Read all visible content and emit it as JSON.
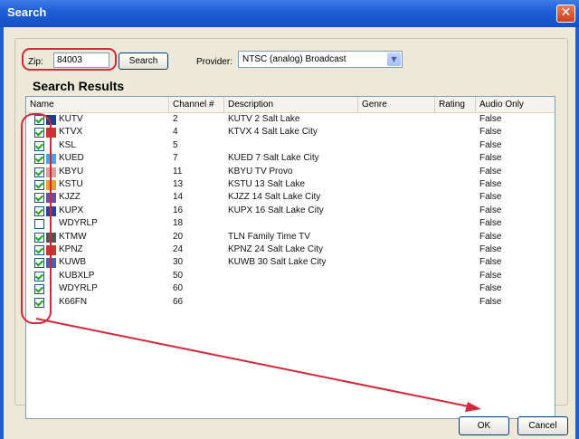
{
  "window": {
    "title": "Search",
    "close_glyph": "✕"
  },
  "search": {
    "zip_label": "Zip:",
    "zip_value": "84003",
    "search_button": "Search",
    "provider_label": "Provider:",
    "provider_value": "NTSC (analog) Broadcast"
  },
  "results": {
    "heading": "Search Results",
    "columns": [
      "Name",
      "Channel #",
      "Description",
      "Genre",
      "Rating",
      "Audio Only"
    ],
    "rows": [
      {
        "checked": true,
        "logo": "#1b3f8c",
        "name": "KUTV",
        "channel": "2",
        "description": "KUTV 2 Salt Lake",
        "genre": "",
        "rating": "",
        "audio_only": "False"
      },
      {
        "checked": true,
        "logo": "#c23b2a",
        "name": "KTVX",
        "channel": "4",
        "description": "KTVX 4 Salt Lake City",
        "genre": "",
        "rating": "",
        "audio_only": "False"
      },
      {
        "checked": true,
        "logo": "",
        "name": "KSL",
        "channel": "5",
        "description": "",
        "genre": "",
        "rating": "",
        "audio_only": "False"
      },
      {
        "checked": true,
        "logo": "#44a7e0",
        "name": "KUED",
        "channel": "7",
        "description": "KUED 7 Salt Lake City",
        "genre": "",
        "rating": "",
        "audio_only": "False"
      },
      {
        "checked": true,
        "logo": "#d9a0a0",
        "name": "KBYU",
        "channel": "11",
        "description": "KBYU TV Provo",
        "genre": "",
        "rating": "",
        "audio_only": "False"
      },
      {
        "checked": true,
        "logo": "#e2a12b",
        "name": "KSTU",
        "channel": "13",
        "description": "KSTU 13 Salt Lake",
        "genre": "",
        "rating": "",
        "audio_only": "False"
      },
      {
        "checked": true,
        "logo": "#6c4fa3",
        "name": "KJZZ",
        "channel": "14",
        "description": "KJZZ 14 Salt Lake City",
        "genre": "",
        "rating": "",
        "audio_only": "False"
      },
      {
        "checked": true,
        "logo": "#2a3f9b",
        "name": "KUPX",
        "channel": "16",
        "description": "KUPX 16 Salt Lake City",
        "genre": "",
        "rating": "",
        "audio_only": "False"
      },
      {
        "checked": false,
        "logo": "",
        "name": "WDYRLP",
        "channel": "18",
        "description": "",
        "genre": "",
        "rating": "",
        "audio_only": "False"
      },
      {
        "checked": true,
        "logo": "#555555",
        "name": "KTMW",
        "channel": "20",
        "description": "TLN Family Time TV",
        "genre": "",
        "rating": "",
        "audio_only": "False"
      },
      {
        "checked": true,
        "logo": "#c0392b",
        "name": "KPNZ",
        "channel": "24",
        "description": "KPNZ 24 Salt Lake City",
        "genre": "",
        "rating": "",
        "audio_only": "False"
      },
      {
        "checked": true,
        "logo": "#4b5fb0",
        "name": "KUWB",
        "channel": "30",
        "description": "KUWB 30 Salt Lake City",
        "genre": "",
        "rating": "",
        "audio_only": "False"
      },
      {
        "checked": true,
        "logo": "",
        "name": "KUBXLP",
        "channel": "50",
        "description": "",
        "genre": "",
        "rating": "",
        "audio_only": "False"
      },
      {
        "checked": true,
        "logo": "",
        "name": "WDYRLP",
        "channel": "60",
        "description": "",
        "genre": "",
        "rating": "",
        "audio_only": "False"
      },
      {
        "checked": true,
        "logo": "",
        "name": "K66FN",
        "channel": "66",
        "description": "",
        "genre": "",
        "rating": "",
        "audio_only": "False"
      }
    ]
  },
  "buttons": {
    "ok": "OK",
    "cancel": "Cancel"
  },
  "colors": {
    "titlebar": "#1f5fd6",
    "annotation": "#d3273b",
    "check": "#21a121"
  }
}
